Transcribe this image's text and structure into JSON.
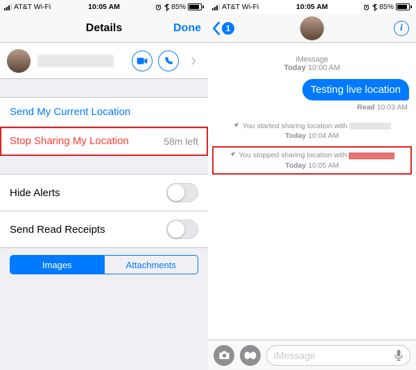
{
  "left": {
    "statusbar": {
      "carrier": "AT&T Wi-Fi",
      "time": "10:05 AM",
      "battery_pct": "85%"
    },
    "nav": {
      "title": "Details",
      "done": "Done"
    },
    "contact": {
      "name_redacted": true
    },
    "actions": {
      "send_location": "Send My Current Location",
      "stop_sharing": "Stop Sharing My Location",
      "stop_sharing_detail": "58m left"
    },
    "settings": {
      "hide_alerts": "Hide Alerts",
      "read_receipts": "Send Read Receipts"
    },
    "segmented": {
      "images": "Images",
      "attachments": "Attachments",
      "selected": "images"
    }
  },
  "right": {
    "statusbar": {
      "carrier": "AT&T Wi-Fi",
      "time": "10:05 AM",
      "battery_pct": "85%"
    },
    "nav": {
      "back_badge": "1"
    },
    "thread": {
      "service": "iMessage",
      "day": "Today",
      "header_time": "10:00 AM",
      "message": "Testing live location",
      "read_label": "Read",
      "read_time": "10:03 AM",
      "started_text": "You started sharing location with",
      "started_time": "10:04 AM",
      "stopped_text": "You stopped sharing location with",
      "stopped_time": "10:05 AM"
    },
    "input": {
      "placeholder": "iMessage"
    }
  }
}
